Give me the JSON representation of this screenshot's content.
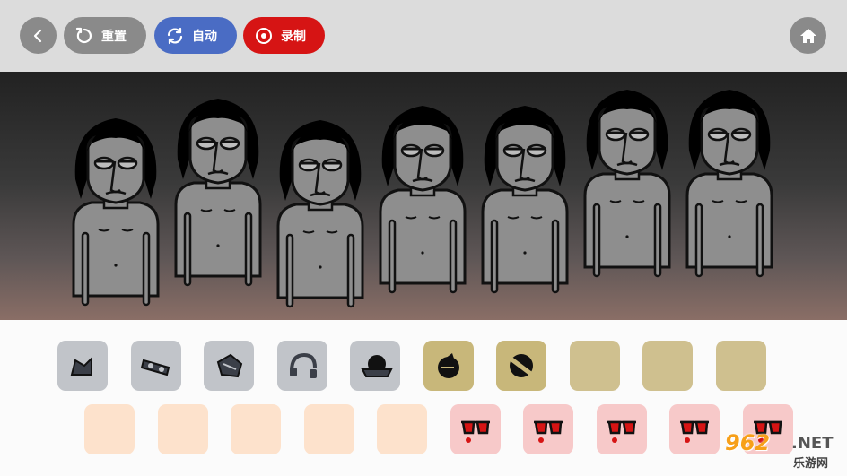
{
  "toolbar": {
    "reset_label": "重置",
    "auto_label": "自动",
    "record_label": "录制",
    "colors": {
      "bar": "#dcdcdc",
      "grey": "#8a8a8a",
      "auto": "#4a6cc4",
      "record": "#d61414"
    }
  },
  "stage": {
    "performer_count": 7,
    "performer_colors": {
      "skin": "#8e8e8e",
      "hair": "#000000",
      "outline": "#111111"
    }
  },
  "palette": {
    "row1": [
      {
        "icon": "hat-icon",
        "state": "grey"
      },
      {
        "icon": "mask-icon",
        "state": "grey"
      },
      {
        "icon": "helmet-icon",
        "state": "grey"
      },
      {
        "icon": "headphones-icon",
        "state": "grey"
      },
      {
        "icon": "cap-icon",
        "state": "grey"
      },
      {
        "icon": "orb-icon",
        "state": "gold"
      },
      {
        "icon": "stripe-ball-icon",
        "state": "gold"
      },
      {
        "icon": "empty-slot",
        "state": "khaki"
      },
      {
        "icon": "empty-slot",
        "state": "khaki"
      },
      {
        "icon": "empty-slot",
        "state": "khaki"
      }
    ],
    "row2": [
      {
        "icon": "empty-slot",
        "state": "peach"
      },
      {
        "icon": "empty-slot",
        "state": "peach"
      },
      {
        "icon": "empty-slot",
        "state": "peach"
      },
      {
        "icon": "empty-slot",
        "state": "peach"
      },
      {
        "icon": "empty-slot",
        "state": "peach"
      },
      {
        "icon": "sunglasses-icon",
        "state": "pink"
      },
      {
        "icon": "sunglasses-icon",
        "state": "pink"
      },
      {
        "icon": "sunglasses-icon",
        "state": "pink"
      },
      {
        "icon": "sunglasses-icon",
        "state": "pink"
      },
      {
        "icon": "sunglasses-icon",
        "state": "pink"
      }
    ]
  },
  "watermark": {
    "number": "962",
    "suffix": ".NET",
    "site": "乐游网"
  }
}
